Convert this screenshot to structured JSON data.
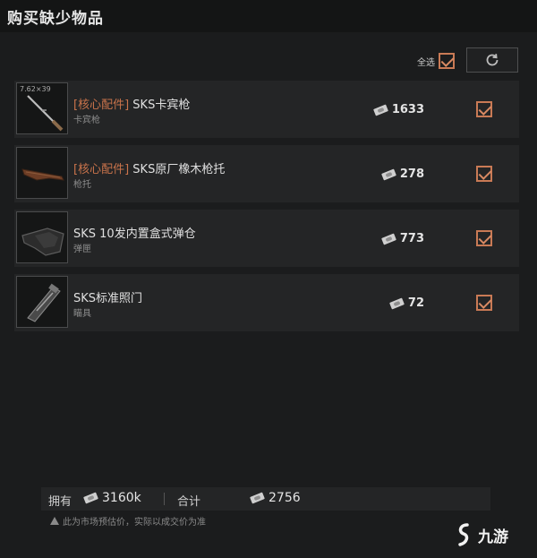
{
  "header": {
    "title": "购买缺少物品"
  },
  "controls": {
    "select_all_label": "全选",
    "refresh_icon": "refresh-icon"
  },
  "items": [
    {
      "tag": "[核心配件]",
      "name": "SKS卡宾枪",
      "subtitle": "卡宾枪",
      "caliber": "7.62×39",
      "price": "1633",
      "checked": true,
      "icon": "rifle-icon"
    },
    {
      "tag": "[核心配件]",
      "name": "SKS原厂橡木枪托",
      "subtitle": "枪托",
      "price": "278",
      "checked": true,
      "icon": "stock-icon"
    },
    {
      "tag": "",
      "name": "SKS 10发内置盒式弹仓",
      "subtitle": "弹匣",
      "price": "773",
      "checked": true,
      "icon": "magazine-icon"
    },
    {
      "tag": "",
      "name": "SKS标准照门",
      "subtitle": "瞄具",
      "price": "72",
      "checked": true,
      "icon": "sight-icon"
    }
  ],
  "footer": {
    "owned_label": "拥有",
    "owned_value": "3160k",
    "total_label": "合计",
    "total_value": "2756",
    "note": "此为市场预估价，实际以成交价为准"
  },
  "watermark": {
    "text": "九游"
  },
  "colors": {
    "accent": "#c9734b",
    "background": "#1b1c1d",
    "row": "#242526"
  }
}
